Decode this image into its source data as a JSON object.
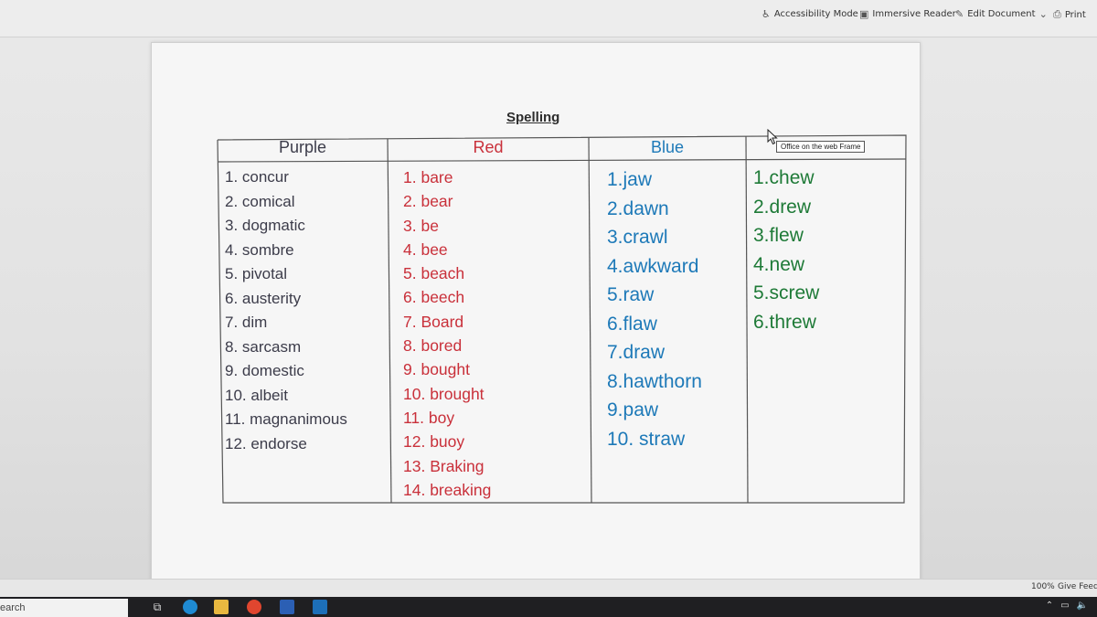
{
  "ribbon": {
    "accessibility": "Accessibility Mode",
    "immersive": "Immersive Reader",
    "edit": "Edit Document",
    "print": "Print"
  },
  "document": {
    "title": "Spelling",
    "columns": [
      {
        "header": "Purple",
        "color": "#3c3c4a",
        "items": [
          "1. concur",
          "2. comical",
          "3. dogmatic",
          "4. sombre",
          "5. pivotal",
          "6. austerity",
          "7. dim",
          "8. sarcasm",
          "9. domestic",
          "10.  albeit",
          "11.  magnanimous",
          "12.  endorse"
        ]
      },
      {
        "header": "Red",
        "color": "#c9303a",
        "items": [
          "1. bare",
          "2. bear",
          "3. be",
          "4. bee",
          "5. beach",
          "6.  beech",
          "7. Board",
          "8. bored",
          "9. bought",
          "10. brought",
          "11. boy",
          "12.  buoy",
          "13. Braking",
          "14.  breaking"
        ]
      },
      {
        "header": "Blue",
        "color": "#1d79b8",
        "items": [
          "1.jaw",
          "2.dawn",
          "3.crawl",
          "4.awkward",
          "5.raw",
          "6.flaw",
          "7.draw",
          "8.hawthorn",
          "9.paw",
          "10.     straw"
        ]
      },
      {
        "header": "",
        "color": "#1e7a37",
        "items": [
          "1.chew",
          "2.drew",
          "3.flew",
          "4.new",
          "5.screw",
          "6.threw"
        ]
      }
    ],
    "tooltip": "Office on the web Frame"
  },
  "status": {
    "zoom": "100%",
    "feedback": "Give Feedb"
  },
  "taskbar": {
    "search": "earch"
  }
}
